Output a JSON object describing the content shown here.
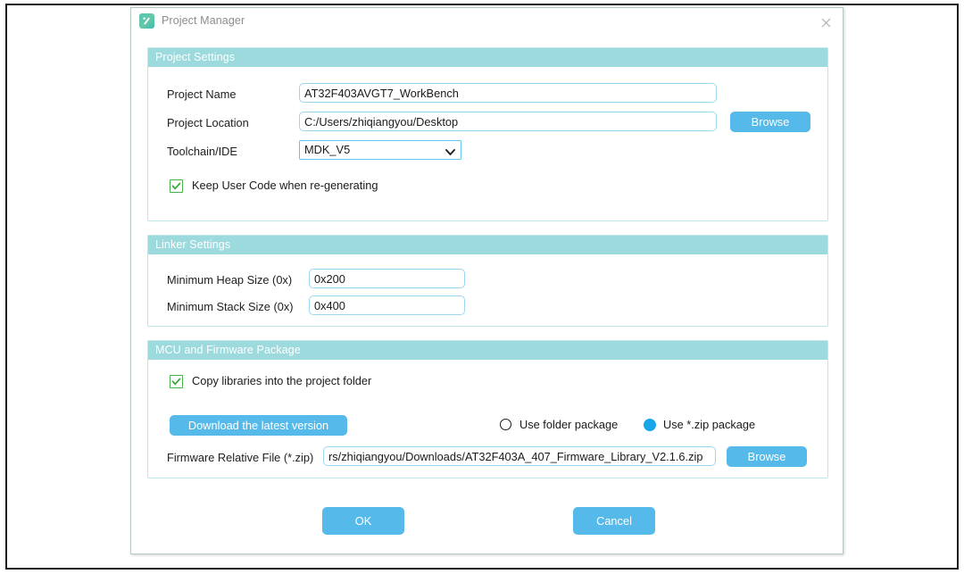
{
  "window": {
    "title": "Project Manager",
    "app_icon": "app-logo-icon",
    "close_icon": "close-icon"
  },
  "colors": {
    "group_header_bg": "#9cdade",
    "group_border": "#bfe6e8",
    "button_blue": "#55b9ea",
    "input_border": "#9fd6ef",
    "checkbox_green": "#46b14a",
    "radio_selected": "#19a6e8"
  },
  "project_settings": {
    "header": "Project Settings",
    "fields": {
      "project_name": {
        "label": "Project Name",
        "value": "AT32F403AVGT7_WorkBench",
        "placeholder": "Project Name"
      },
      "project_location": {
        "label": "Project Location",
        "value": "C:/Users/zhiqiangyou/Desktop",
        "placeholder": "Project Location",
        "browse_label": "Browse"
      },
      "toolchain_ide": {
        "label": "Toolchain/IDE",
        "value": "MDK_V5",
        "options": [
          "MDK_V5"
        ]
      }
    },
    "keep_user_code": {
      "label": "Keep User Code when re-generating",
      "checked": true
    }
  },
  "linker_settings": {
    "header": "Linker Settings",
    "fields": {
      "heap": {
        "label": "Minimum Heap Size (0x)",
        "value": "0x200",
        "placeholder": "0x200"
      },
      "stack": {
        "label": "Minimum Stack Size (0x)",
        "value": "0x400",
        "placeholder": "0x400"
      }
    }
  },
  "mcu_firmware": {
    "header": "MCU and Firmware Package",
    "copy_libraries": {
      "label": "Copy libraries into the project folder",
      "checked": true
    },
    "download_label": "Download the latest version",
    "package_mode": {
      "folder": {
        "label": "Use folder package",
        "selected": false
      },
      "zip": {
        "label": "Use *.zip package",
        "selected": true
      }
    },
    "firmware_file": {
      "label": "Firmware Relative File (*.zip)",
      "value": "rs/zhiqiangyou/Downloads/AT32F403A_407_Firmware_Library_V2.1.6.zip",
      "placeholder": "Firmware Relative File (*.zip)",
      "browse_label": "Browse"
    }
  },
  "footer": {
    "ok_label": "OK",
    "cancel_label": "Cancel"
  }
}
